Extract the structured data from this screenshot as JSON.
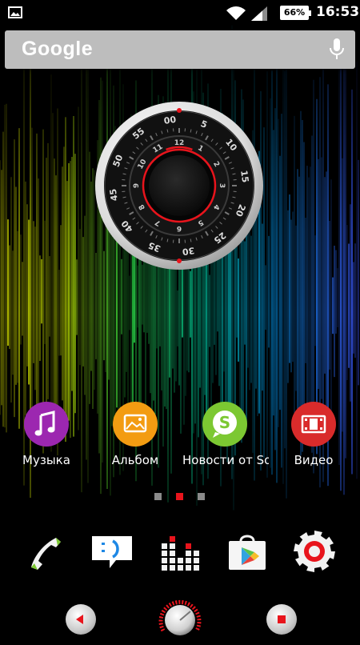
{
  "status_bar": {
    "battery_percent": "66%",
    "time": "16:53",
    "icons": [
      "gallery-icon",
      "wifi-icon",
      "signal-icon",
      "battery-icon"
    ]
  },
  "search": {
    "logo_text": "Google",
    "mic_icon": "microphone-icon"
  },
  "clock_widget": {
    "minute_ring": [
      "5",
      "10",
      "15",
      "20",
      "25",
      "30",
      "35",
      "40",
      "45",
      "50",
      "55",
      "00"
    ],
    "hour_ring": [
      "1",
      "2",
      "3",
      "4",
      "5",
      "6",
      "7",
      "8",
      "9",
      "10",
      "11",
      "12"
    ]
  },
  "apps": [
    {
      "label": "Музыка",
      "icon": "music-note-icon",
      "color": "#9c27b0"
    },
    {
      "label": "Альбом",
      "icon": "album-icon",
      "color": "#f39c12"
    },
    {
      "label": "Новости от Sony",
      "icon": "socialife-icon",
      "color": "#7cc832"
    },
    {
      "label": "Видео",
      "icon": "film-icon",
      "color": "#d92b2b"
    }
  ],
  "page_indicator": {
    "pages": 3,
    "current": 2
  },
  "dock": [
    {
      "icon": "phone-icon"
    },
    {
      "icon": "messaging-icon"
    },
    {
      "icon": "all-apps-icon"
    },
    {
      "icon": "play-store-icon"
    },
    {
      "icon": "settings-icon"
    }
  ],
  "nav": {
    "back_icon": "back-icon",
    "home_icon": "home-icon",
    "recents_icon": "recents-icon"
  },
  "colors": {
    "accent": "#e8141c",
    "search_bg": "#bdbdbd"
  }
}
